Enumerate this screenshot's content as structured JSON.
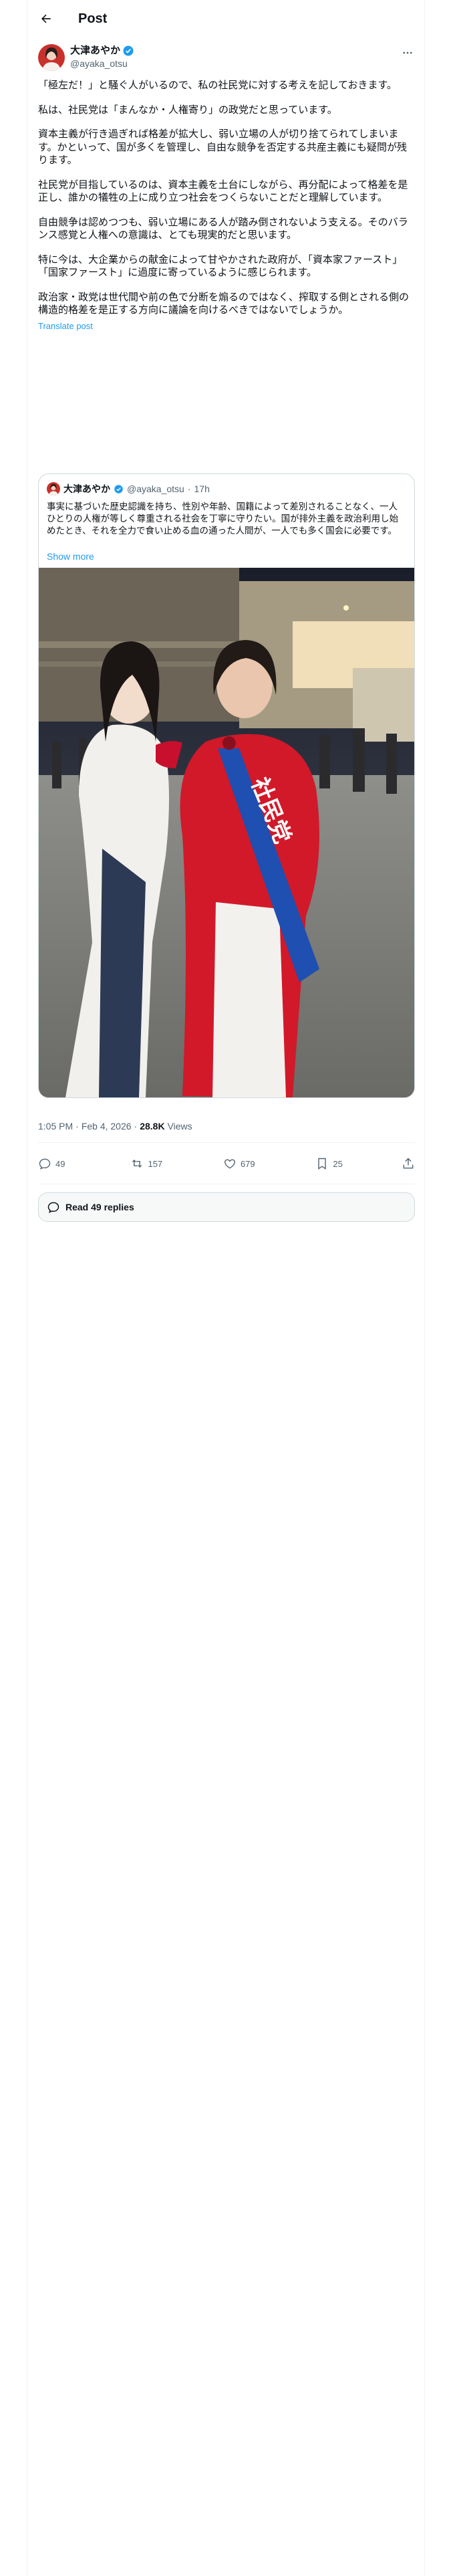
{
  "header": {
    "title": "Post"
  },
  "author": {
    "name": "大津あやか",
    "handle": "@ayaka_otsu"
  },
  "post": {
    "paragraphs": [
      "「極左だ！」と騒ぐ人がいるので、私の社民党に対する考えを記しておきます。",
      "私は、社民党は「まんなか・人権寄り」の政党だと思っています。",
      "資本主義が行き過ぎれば格差が拡大し、弱い立場の人が切り捨てられてしまいます。かといって、国が多くを管理し、自由な競争を否定する共産主義にも疑問が残ります。",
      "社民党が目指しているのは、資本主義を土台にしながら、再分配によって格差を是正し、誰かの犠牲の上に成り立つ社会をつくらないことだと理解しています。",
      "自由競争は認めつつも、弱い立場にある人が踏み倒されないよう支える。そのバランス感覚と人権への意識は、とても現実的だと思います。",
      "特に今は、大企業からの献金によって甘やかされた政府が、「資本家ファースト」「国家ファースト」に過度に寄っているように感じられます。",
      "政治家・政党は世代間や前の色で分断を煽るのではなく、搾取する側とされる側の構造的格差を是正する方向に議論を向けるべきではないでしょうか。"
    ],
    "translate": "Translate post"
  },
  "quote": {
    "name": "大津あやか",
    "handle": "@ayaka_otsu",
    "time": "17h",
    "text": "事実に基づいた歴史認識を持ち、性別や年齢、国籍によって差別されることなく、一人ひとりの人権が等しく尊重される社会を丁寧に守りたい。国が排外主義を政治利用し始めたとき、それを全力で食い止める血の通った人間が、一人でも多く国会に必要です。",
    "show_more": "Show more",
    "sash_text": "社民党"
  },
  "meta": {
    "time": "1:05 PM",
    "date": "Feb 4, 2026",
    "views": "28.8K",
    "views_label": "Views"
  },
  "actions": {
    "replies": "49",
    "reposts": "157",
    "likes": "679",
    "bookmarks": "25"
  },
  "read_replies": "Read 49 replies",
  "colors": {
    "accent": "#1d9bf0",
    "verified": "#1d9bf0",
    "text": "#0f1419",
    "muted": "#536471"
  }
}
